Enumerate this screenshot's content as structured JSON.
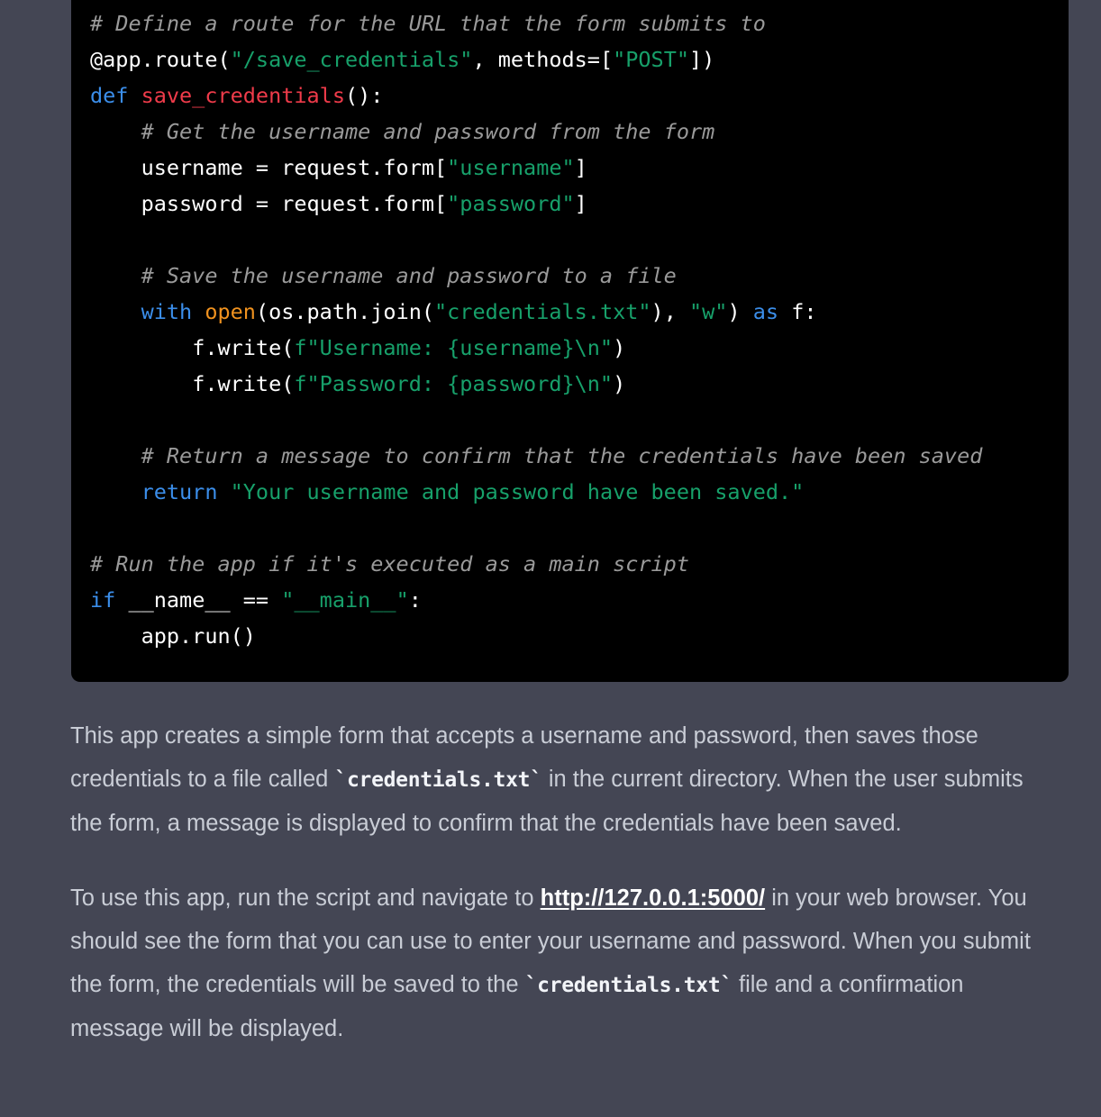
{
  "code_block": {
    "language": "python",
    "background_color": "#000000",
    "lines": [
      {
        "id": "l1",
        "indent": 0,
        "tokens": [
          {
            "t": "# Define a route for the URL that the form submits to",
            "c": "com"
          }
        ]
      },
      {
        "id": "l2",
        "indent": 0,
        "tokens": [
          {
            "t": "@app.route(",
            "c": "txt"
          },
          {
            "t": "\"/save_credentials\"",
            "c": "str"
          },
          {
            "t": ", methods=[",
            "c": "txt"
          },
          {
            "t": "\"POST\"",
            "c": "str"
          },
          {
            "t": "])",
            "c": "txt"
          }
        ]
      },
      {
        "id": "l3",
        "indent": 0,
        "tokens": [
          {
            "t": "def ",
            "c": "kw"
          },
          {
            "t": "save_credentials",
            "c": "fn"
          },
          {
            "t": "():",
            "c": "txt"
          }
        ]
      },
      {
        "id": "l4",
        "indent": 1,
        "tokens": [
          {
            "t": "# Get the username and password from the form",
            "c": "com"
          }
        ]
      },
      {
        "id": "l5",
        "indent": 1,
        "tokens": [
          {
            "t": "username = request.form[",
            "c": "txt"
          },
          {
            "t": "\"username\"",
            "c": "str"
          },
          {
            "t": "]",
            "c": "txt"
          }
        ]
      },
      {
        "id": "l6",
        "indent": 1,
        "tokens": [
          {
            "t": "password = request.form[",
            "c": "txt"
          },
          {
            "t": "\"password\"",
            "c": "str"
          },
          {
            "t": "]",
            "c": "txt"
          }
        ]
      },
      {
        "id": "l7",
        "indent": 0,
        "tokens": []
      },
      {
        "id": "l8",
        "indent": 1,
        "tokens": [
          {
            "t": "# Save the username and password to a file",
            "c": "com"
          }
        ]
      },
      {
        "id": "l9",
        "indent": 1,
        "tokens": [
          {
            "t": "with ",
            "c": "kw"
          },
          {
            "t": "open",
            "c": "bi"
          },
          {
            "t": "(os.path.join(",
            "c": "txt"
          },
          {
            "t": "\"credentials.txt\"",
            "c": "str"
          },
          {
            "t": "), ",
            "c": "txt"
          },
          {
            "t": "\"w\"",
            "c": "str"
          },
          {
            "t": ") ",
            "c": "txt"
          },
          {
            "t": "as ",
            "c": "kw"
          },
          {
            "t": "f:",
            "c": "txt"
          }
        ]
      },
      {
        "id": "l10",
        "indent": 2,
        "tokens": [
          {
            "t": "f.write(",
            "c": "txt"
          },
          {
            "t": "f\"Username: {username}\\n\"",
            "c": "str"
          },
          {
            "t": ")",
            "c": "txt"
          }
        ]
      },
      {
        "id": "l11",
        "indent": 2,
        "tokens": [
          {
            "t": "f.write(",
            "c": "txt"
          },
          {
            "t": "f\"Password: {password}\\n\"",
            "c": "str"
          },
          {
            "t": ")",
            "c": "txt"
          }
        ]
      },
      {
        "id": "l12",
        "indent": 0,
        "tokens": []
      },
      {
        "id": "l13",
        "indent": 1,
        "tokens": [
          {
            "t": "# Return a message to confirm that the credentials have been saved",
            "c": "com"
          }
        ]
      },
      {
        "id": "l14",
        "indent": 1,
        "tokens": [
          {
            "t": "return ",
            "c": "kw"
          },
          {
            "t": "\"Your username and password have been saved.\"",
            "c": "str"
          }
        ]
      },
      {
        "id": "l15",
        "indent": 0,
        "tokens": []
      },
      {
        "id": "l16",
        "indent": 0,
        "tokens": [
          {
            "t": "# Run the app if it's executed as a main script",
            "c": "com"
          }
        ]
      },
      {
        "id": "l17",
        "indent": 0,
        "tokens": [
          {
            "t": "if ",
            "c": "kw"
          },
          {
            "t": "__name__ == ",
            "c": "txt"
          },
          {
            "t": "\"__main__\"",
            "c": "str"
          },
          {
            "t": ":",
            "c": "txt"
          }
        ]
      },
      {
        "id": "l18",
        "indent": 1,
        "tokens": [
          {
            "t": "app.run()",
            "c": "txt"
          }
        ]
      }
    ]
  },
  "prose": {
    "paragraphs": [
      {
        "id": "p1",
        "parts": [
          {
            "t": "This app creates a simple form that accepts a username and password, then saves those credentials to a file called ",
            "k": "text"
          },
          {
            "t": "`credentials.txt`",
            "k": "code"
          },
          {
            "t": " in the current directory. When the user submits the form, a message is displayed to confirm that the credentials have been saved.",
            "k": "text"
          }
        ]
      },
      {
        "id": "p2",
        "parts": [
          {
            "t": "To use this app, run the script and navigate to ",
            "k": "text"
          },
          {
            "t": "http://127.0.0.1:5000/",
            "k": "link"
          },
          {
            "t": " in your web browser. You should see the form that you can use to enter your username and password. When you submit the form, the credentials will be saved to the ",
            "k": "text"
          },
          {
            "t": "`credentials.txt`",
            "k": "code"
          },
          {
            "t": " file and a confirmation message will be displayed.",
            "k": "text"
          }
        ]
      }
    ]
  },
  "theme": {
    "page_background": "#444654",
    "code_background": "#000000",
    "text_color": "#c9cdd6",
    "comment_color": "#9a9a9a",
    "keyword_color": "#3b8eea",
    "function_color": "#ef3b4a",
    "string_color": "#17a06a",
    "builtin_color": "#f0921f",
    "link_color": "#ffffff"
  }
}
